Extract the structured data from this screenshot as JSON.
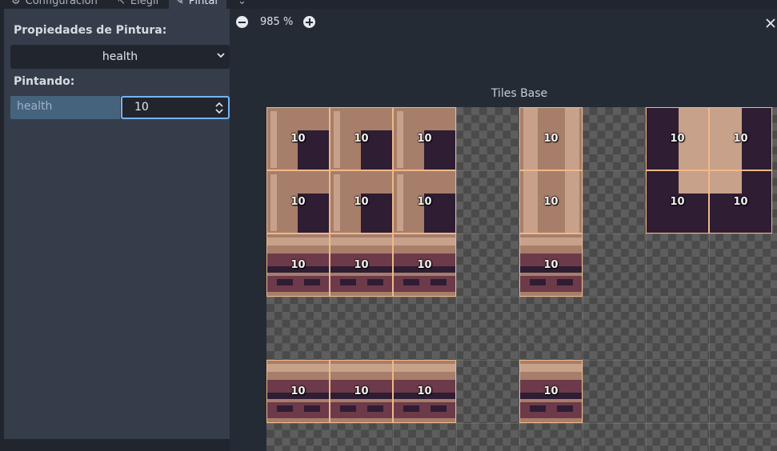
{
  "tabs": [
    {
      "label": "Configuración",
      "icon": "settings-icon",
      "active": false
    },
    {
      "label": "Elegir",
      "icon": "pick-icon",
      "active": false
    },
    {
      "label": "Pintar",
      "icon": "paint-icon",
      "active": true
    },
    {
      "label": "",
      "icon": "more-icon",
      "active": false
    }
  ],
  "left_panel": {
    "properties_label": "Propiedades de Pintura:",
    "property_selected": "health",
    "painting_label": "Pintando:",
    "property_name": "health",
    "property_value": "10"
  },
  "viewer": {
    "zoom_label": "985 %",
    "atlas_title": "Tiles Base",
    "tile_value": "10"
  },
  "colors": {
    "accent": "#74b5f4",
    "tile_border": "#f1b887",
    "panel_bg": "#363d4a"
  }
}
